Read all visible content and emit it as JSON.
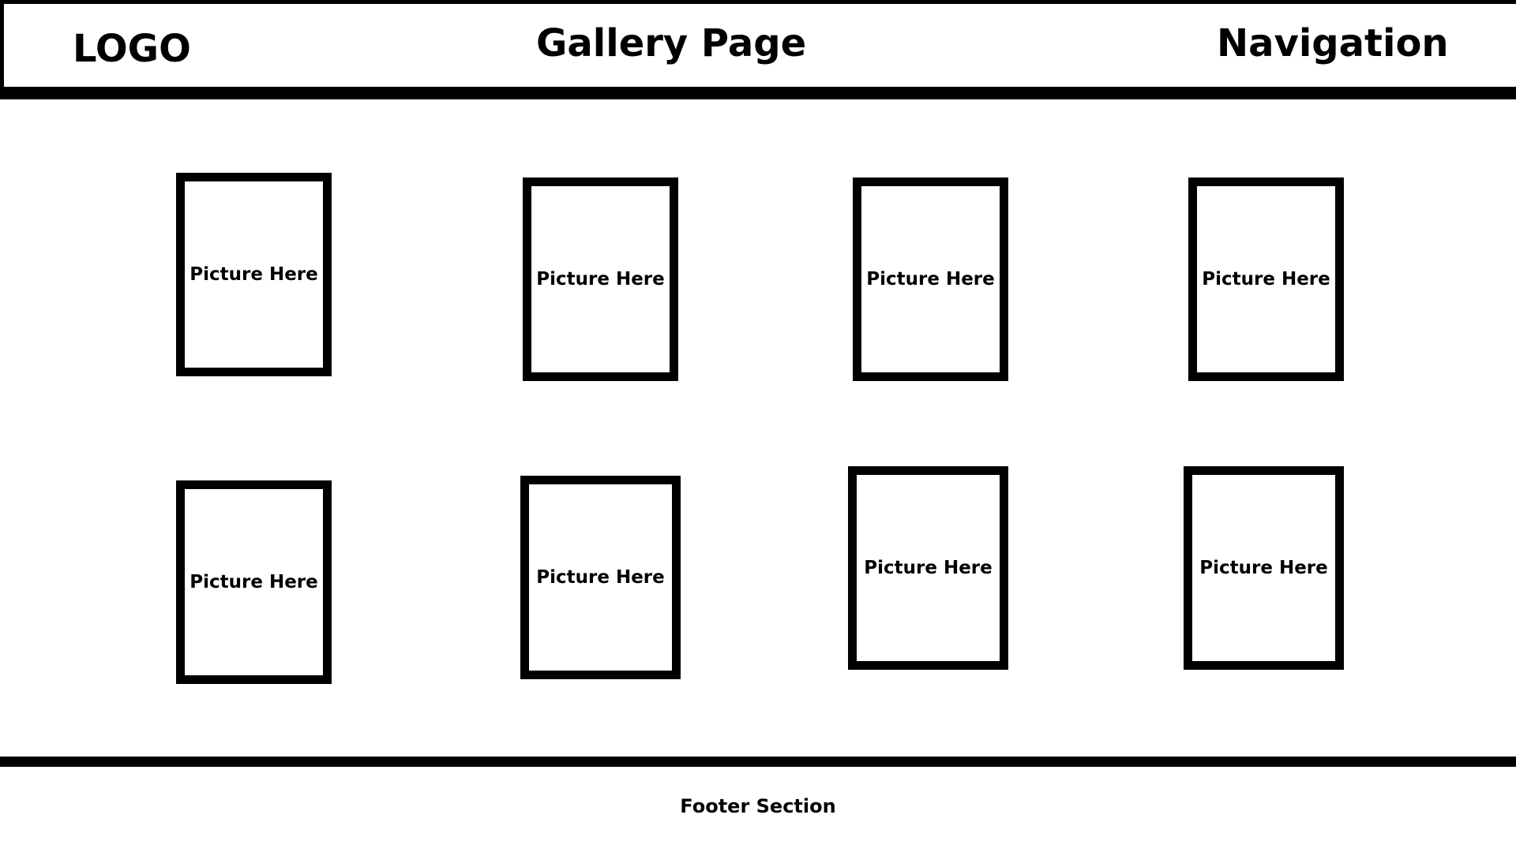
{
  "header": {
    "logo": "LOGO",
    "title": "Gallery Page",
    "navigation": "Navigation"
  },
  "gallery": {
    "items": [
      {
        "label": "Picture Here"
      },
      {
        "label": "Picture Here"
      },
      {
        "label": "Picture Here"
      },
      {
        "label": "Picture Here"
      },
      {
        "label": "Picture Here"
      },
      {
        "label": "Picture Here"
      },
      {
        "label": "Picture Here"
      },
      {
        "label": "Picture Here"
      }
    ]
  },
  "footer": {
    "text": "Footer Section"
  }
}
